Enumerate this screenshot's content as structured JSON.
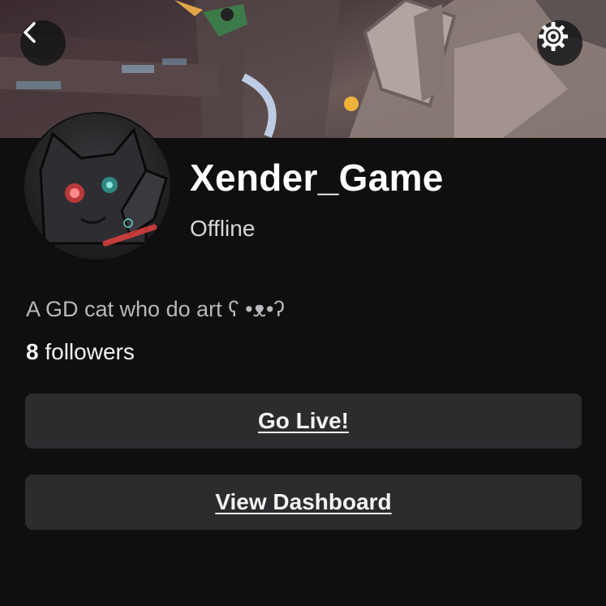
{
  "profile": {
    "username": "Xender_Game",
    "status": "Offline",
    "bio": "A GD cat who do art ʕ •ᴥ•ʔ",
    "followers_count": "8",
    "followers_label": "followers"
  },
  "actions": {
    "go_live_label": "Go Live!",
    "dashboard_label": "View Dashboard"
  },
  "icons": {
    "back": "chevron-left-icon",
    "settings": "gear-icon"
  },
  "colors": {
    "background": "#0f0f10",
    "button_bg": "#2c2c2f",
    "text_primary": "#ffffff",
    "text_secondary": "#b8b8bc"
  }
}
